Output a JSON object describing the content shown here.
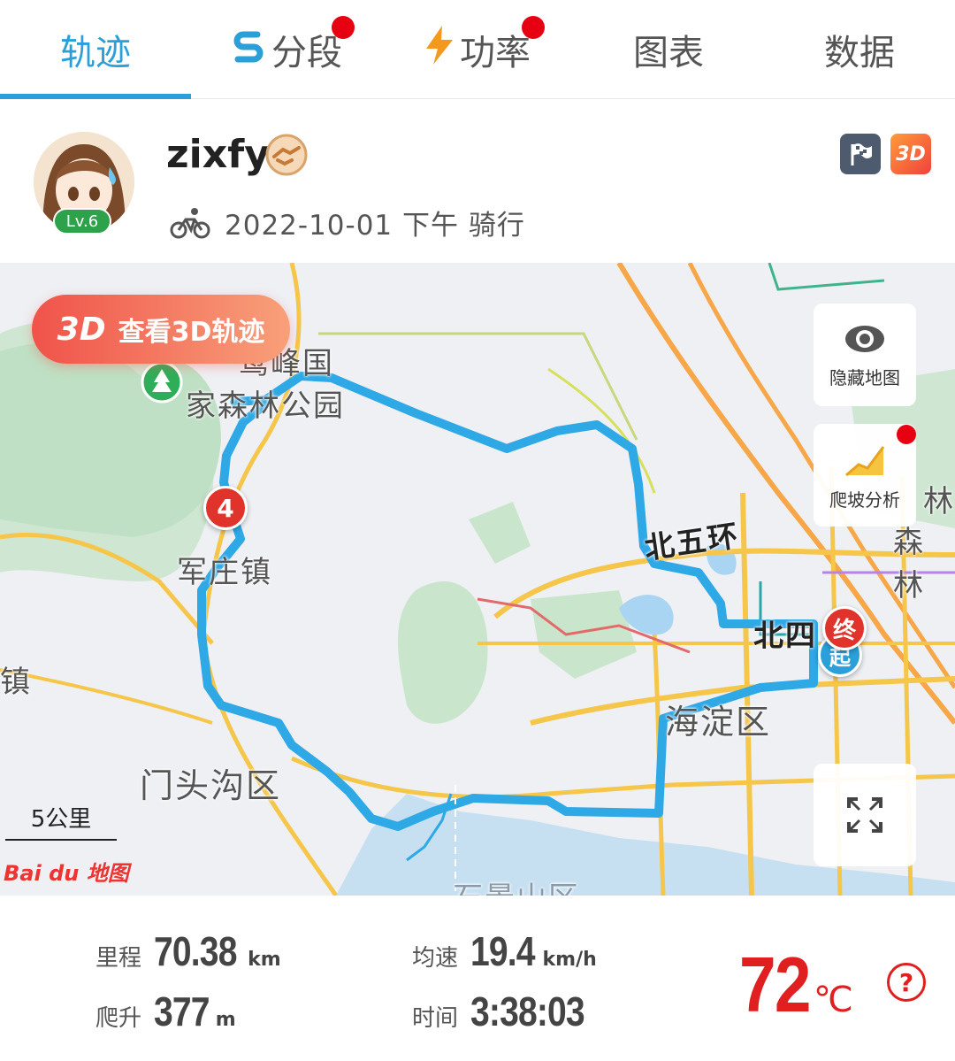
{
  "tabs": [
    {
      "label": "轨迹",
      "active": true
    },
    {
      "label": "分段",
      "has_dot": true
    },
    {
      "label": "功率",
      "has_dot": true
    },
    {
      "label": "图表"
    },
    {
      "label": "数据"
    }
  ],
  "profile": {
    "username": "zixfy",
    "level": "Lv.6",
    "ride_info": "2022-10-01 下午 骑行",
    "badge_3d": "3D"
  },
  "map": {
    "view_3d_button": {
      "badge": "3D",
      "label": "查看3D轨迹"
    },
    "hide_map_label": "隐藏地图",
    "climb_analysis_label": "爬坡分析",
    "scale_label": "5公里",
    "logo_text": "Bai du 地图",
    "place_labels": {
      "forest_park_line1": "鹫峰国",
      "forest_park_line2": "家森林公园",
      "junzhuang": "军庄镇",
      "mentougou": "门头沟区",
      "haidian": "海淀区",
      "north_5th_ring": "北五环",
      "north_4th_ring": "北四",
      "zhen": "镇",
      "lin": "林",
      "senlin": "森林",
      "shijingshan": "石景山区"
    },
    "markers": {
      "point_4": "4",
      "end": "终",
      "start": "起"
    },
    "colors": {
      "route": "#2fa8e6",
      "end_marker": "#e0332b",
      "start_marker": "#2a9fd8"
    }
  },
  "stats": {
    "distance": {
      "label": "里程",
      "value": "70.38",
      "unit": "km"
    },
    "climb": {
      "label": "爬升",
      "value": "377",
      "unit": "m"
    },
    "avg_speed": {
      "label": "均速",
      "value": "19.4",
      "unit": "km/h"
    },
    "time": {
      "label": "时间",
      "value": "3:38:03"
    },
    "temperature": {
      "value": "72",
      "unit": "℃",
      "help": "?"
    }
  }
}
